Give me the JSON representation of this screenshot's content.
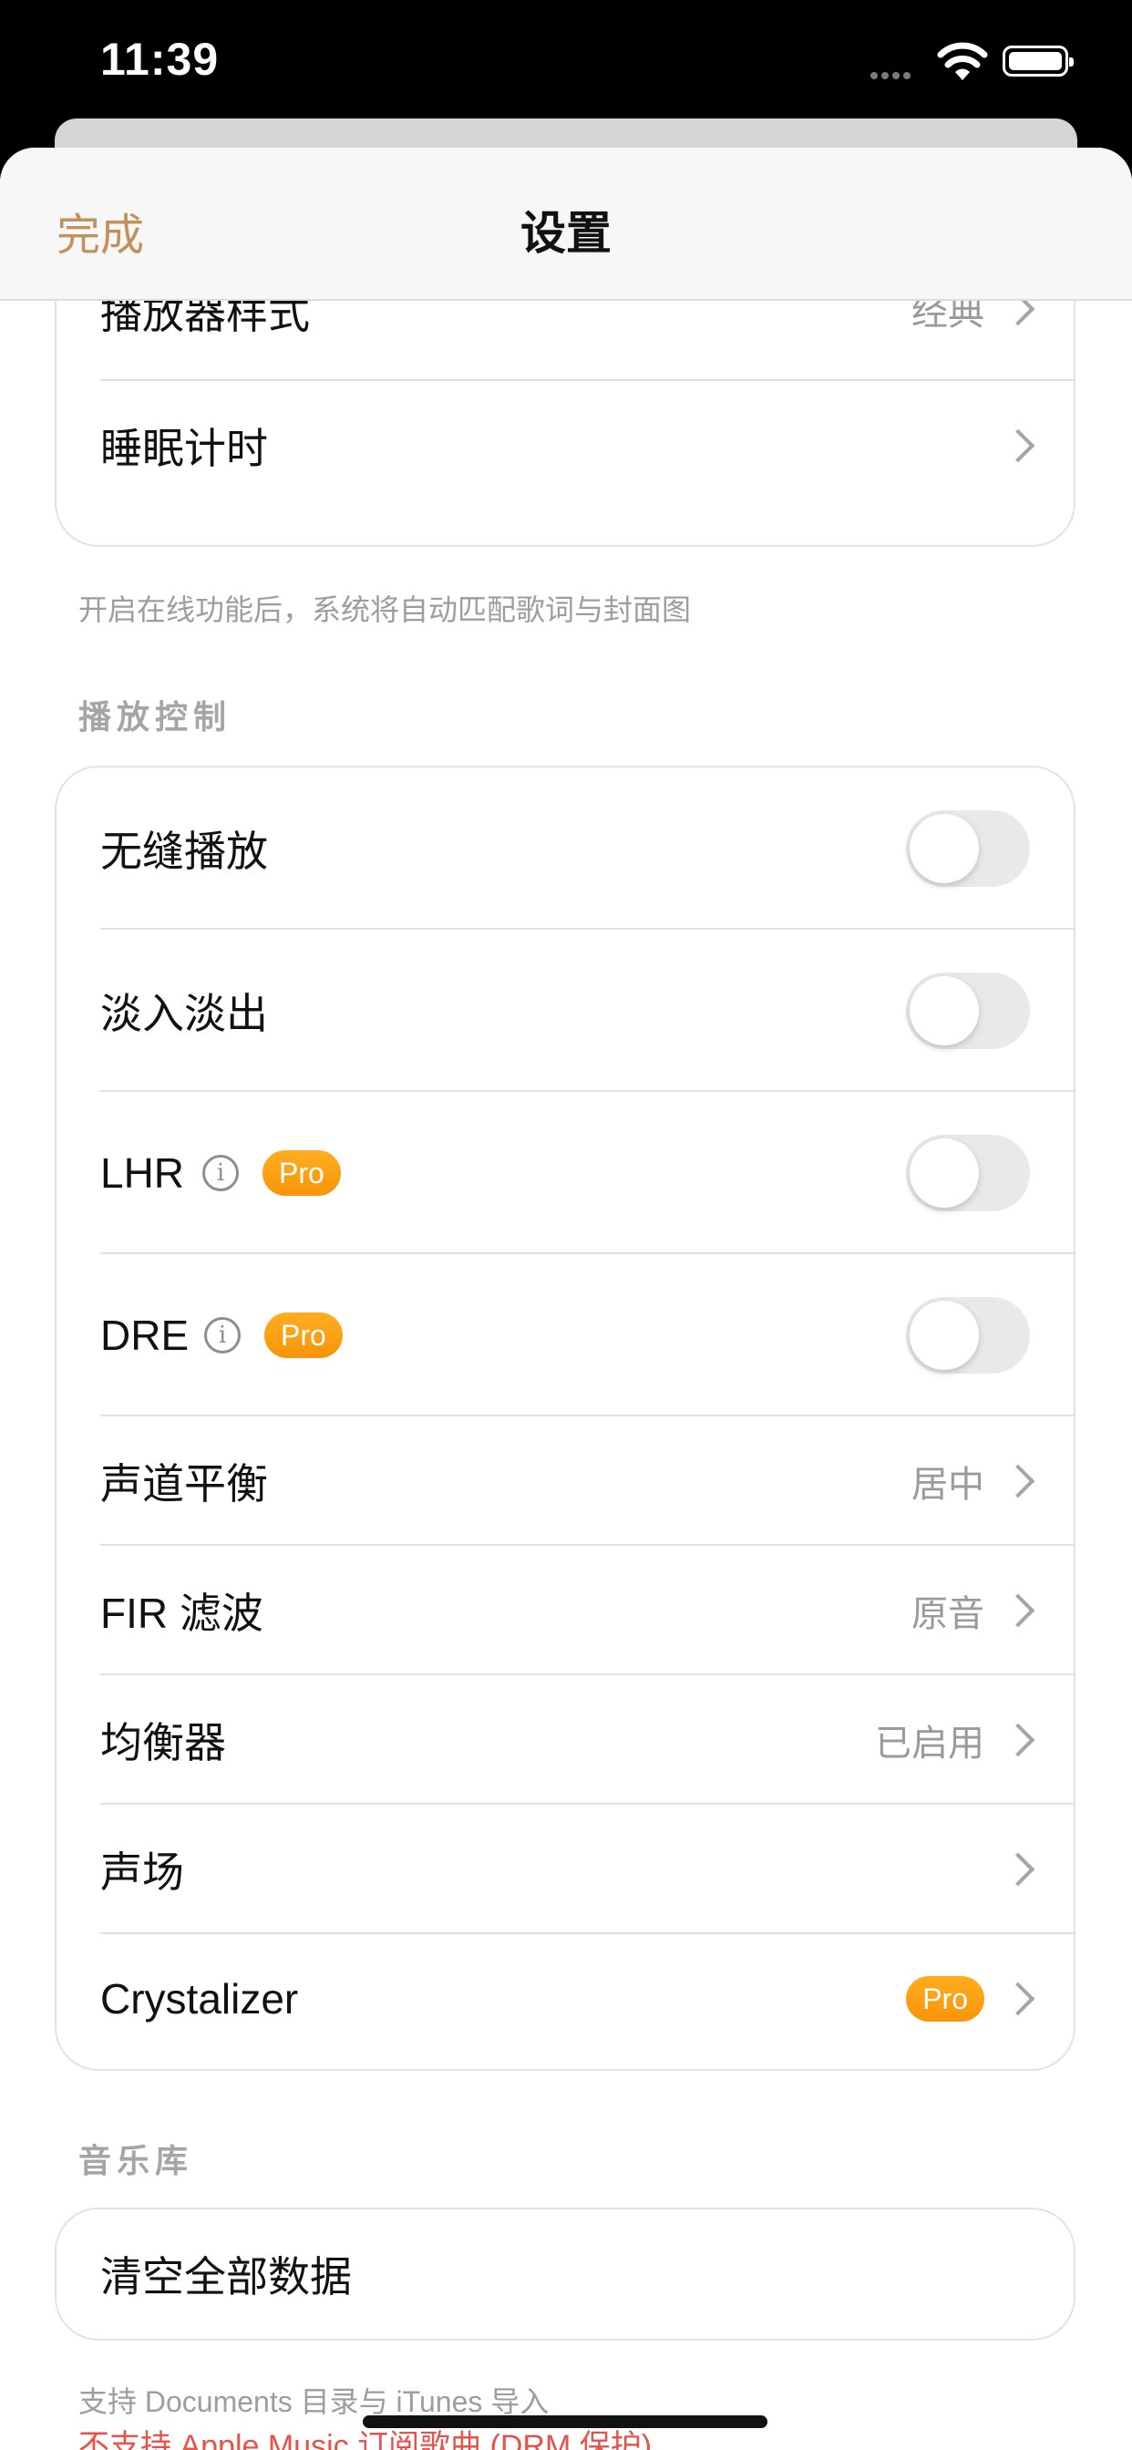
{
  "status_bar": {
    "time": "11:39"
  },
  "nav": {
    "done_label": "完成",
    "title": "设置"
  },
  "top_card": [
    {
      "label": "播放器样式",
      "value": "经典"
    },
    {
      "label": "睡眠计时",
      "value": ""
    }
  ],
  "online_note": "开启在线功能后，系统将自动匹配歌词与封面图",
  "playback": {
    "header": "播放控制",
    "seamless": {
      "label": "无缝播放",
      "enabled": false
    },
    "fade": {
      "label": "淡入淡出",
      "enabled": false
    },
    "lhr": {
      "label": "LHR",
      "badge": "Pro",
      "enabled": false
    },
    "dre": {
      "label": "DRE",
      "badge": "Pro",
      "enabled": false
    },
    "balance": {
      "label": "声道平衡",
      "value": "居中"
    },
    "fir": {
      "label": "FIR 滤波",
      "value": "原音"
    },
    "eq": {
      "label": "均衡器",
      "value": "已启用"
    },
    "soundstage": {
      "label": "声场"
    },
    "crystalizer": {
      "label": "Crystalizer",
      "badge": "Pro"
    }
  },
  "library": {
    "header": "音乐库",
    "clear_label": "清空全部数据",
    "note": "支持 Documents 目录与 iTunes 导入",
    "warning": "不支持 Apple Music 订阅歌曲 (DRM 保护)"
  },
  "colors": {
    "accent": "#c0915a",
    "pro_badge": "#f7940a",
    "warning": "#e5534b"
  }
}
